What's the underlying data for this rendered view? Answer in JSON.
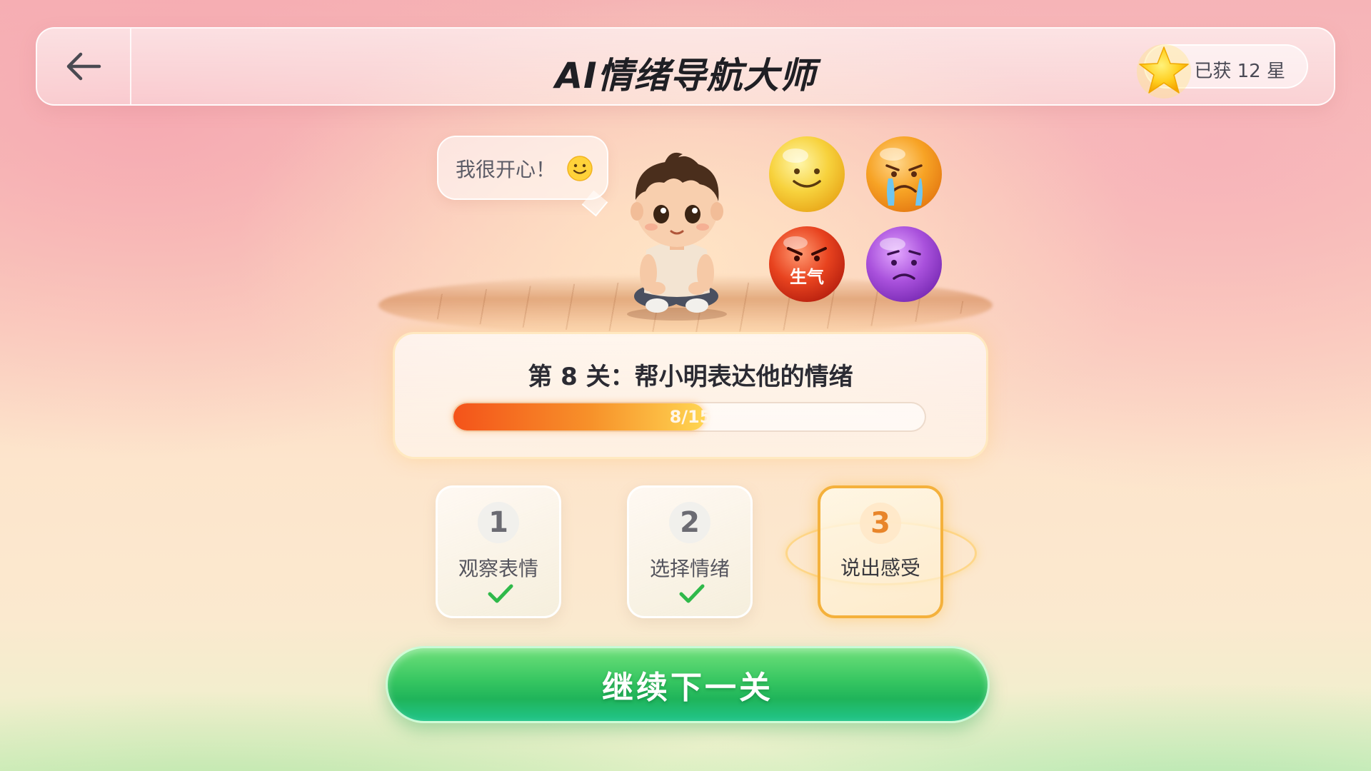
{
  "header": {
    "title": "AI情绪导航大师",
    "stars_text": "已获 12 星"
  },
  "scene": {
    "speech_text": "我很开心！",
    "emotions": [
      {
        "name": "happy",
        "color": "#f7c53a"
      },
      {
        "name": "crying",
        "color": "#f59b22"
      },
      {
        "name": "angry",
        "color": "#e53b22",
        "label": "生气"
      },
      {
        "name": "worried",
        "color": "#a24ed6"
      }
    ]
  },
  "level": {
    "title": "第 8 关：帮小明表达他的情绪",
    "progress_text": "8/15",
    "progress_current": 8,
    "progress_total": 15
  },
  "steps": [
    {
      "number": "1",
      "label": "观察表情",
      "done": true
    },
    {
      "number": "2",
      "label": "选择情绪",
      "done": true
    },
    {
      "number": "3",
      "label": "说出感受",
      "done": false,
      "active": true
    }
  ],
  "actions": {
    "continue_label": "继续下一关"
  },
  "colors": {
    "accent_orange": "#f4b13c",
    "progress_start": "#f4531a",
    "progress_end": "#ffd552",
    "continue_green": "#36c661",
    "check_green": "#2fb94a"
  }
}
